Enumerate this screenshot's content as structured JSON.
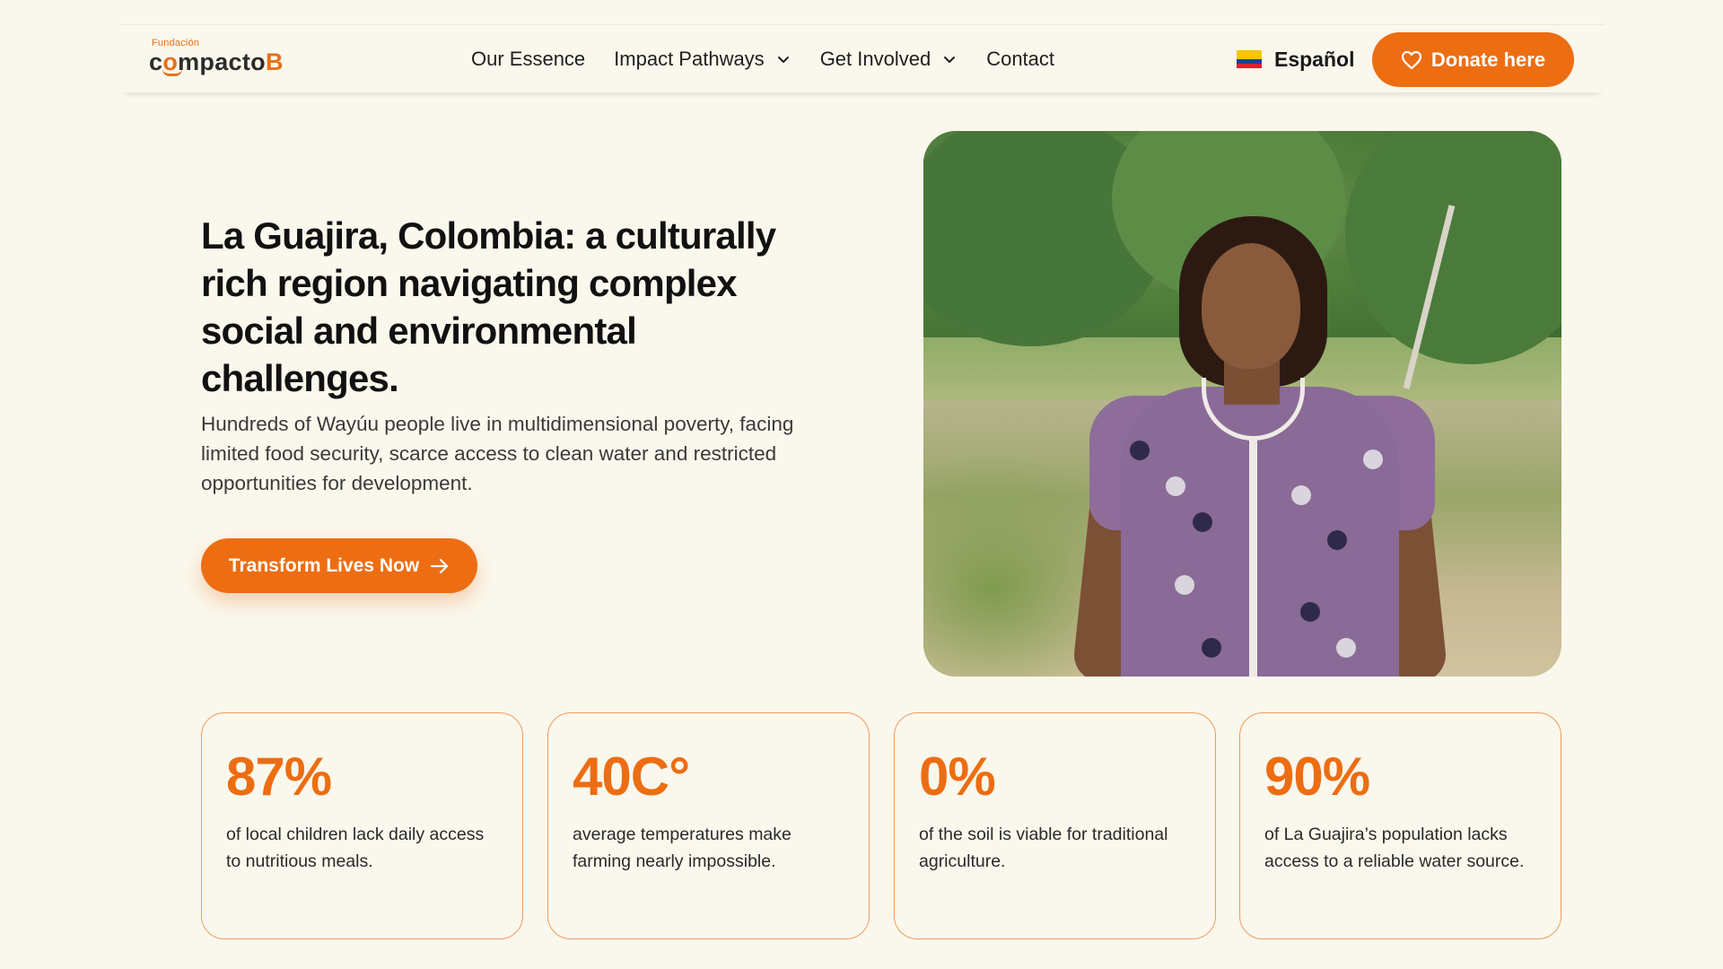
{
  "header": {
    "logo": {
      "small": "Fundación",
      "main_prefix": "c",
      "main_o": "o",
      "main_mid": "mpacto",
      "main_b": "B"
    },
    "nav": [
      {
        "label": "Our Essence",
        "has_dropdown": false
      },
      {
        "label": "Impact Pathways",
        "has_dropdown": true
      },
      {
        "label": "Get Involved",
        "has_dropdown": true
      },
      {
        "label": "Contact",
        "has_dropdown": false
      }
    ],
    "language": {
      "label": "Español",
      "flag_icon": "colombia-flag-icon"
    },
    "donate_label": "Donate here"
  },
  "hero": {
    "title": "La Guajira, Colombia: a culturally rich region navigating complex social and environmental challenges.",
    "subtitle": "Hundreds of Wayúu people live in multidimensional poverty, facing limited food security, scarce access to clean water and restricted opportunities for development.",
    "cta_label": "Transform Lives Now"
  },
  "stats": [
    {
      "value": "87%",
      "description": "of local children lack daily access to nutritious meals."
    },
    {
      "value": "40C°",
      "description": "average temperatures make farming nearly impossible."
    },
    {
      "value": "0%",
      "description": "of the soil is viable for traditional agriculture."
    },
    {
      "value": "90%",
      "description": "of La Guajira’s population lacks access to a reliable water source."
    }
  ],
  "colors": {
    "accent": "#ed6d12",
    "background": "#faf7ec",
    "card_border": "#ef9c5c",
    "text": "#1a1a1a"
  }
}
